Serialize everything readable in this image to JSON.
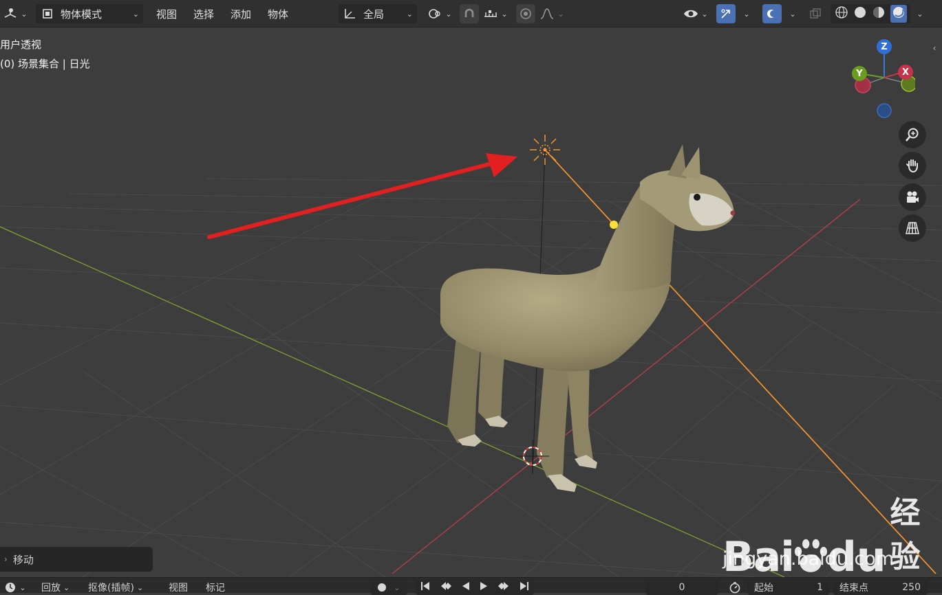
{
  "header": {
    "mode_label": "物体模式",
    "menus": [
      "视图",
      "选择",
      "添加",
      "物体"
    ],
    "transform_orientation": "全局"
  },
  "viewport": {
    "view_name": "用户透视",
    "collection_info": "(0) 场景集合 | 日光",
    "gizmo_axes": {
      "z": "Z",
      "y": "Y",
      "x": "X"
    }
  },
  "operator_panel": {
    "label": "移动"
  },
  "timeline": {
    "playback_label": "回放",
    "keying_label": "抠像(插帧)",
    "view_label": "视图",
    "marker_label": "标记",
    "current_frame": "0",
    "start_label": "起始",
    "start_value": "1",
    "end_label": "结束点",
    "end_value": "250"
  },
  "watermark": {
    "brand_a": "Bai",
    "brand_b": "du",
    "brand_c": "经验",
    "url": "jingyan.baidu.com"
  },
  "colors": {
    "accent_blue": "#4a71b3",
    "light_orange": "#ff9a2e",
    "axis_red": "#b8404d",
    "axis_green": "#7ea132",
    "arrow_red": "#e32020",
    "model_fur": "#a39a77"
  }
}
